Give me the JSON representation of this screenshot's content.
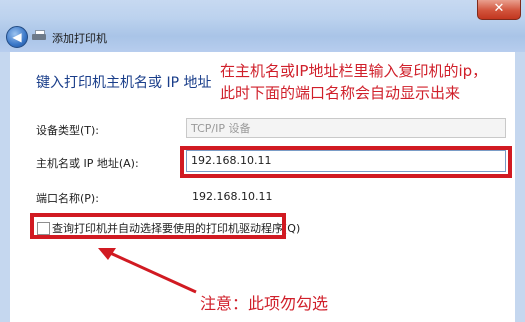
{
  "window": {
    "title": "添加打印机",
    "close_symbol": "✕",
    "back_symbol": "◀"
  },
  "main": {
    "heading": "键入打印机主机名或 IP 地址",
    "annotation_line1": "在主机名或IP地址栏里输入复印机的ip，",
    "annotation_line2": "此时下面的端口名称会自动显示出来",
    "device_type_label": "设备类型(T):",
    "device_type_value": "TCP/IP 设备",
    "host_label": "主机名或 IP 地址(A):",
    "host_value": "192.168.10.11",
    "port_label": "端口名称(P):",
    "port_value": "192.168.10.11",
    "query_checkbox_label": "查询打印机并自动选择要使用的打印机驱动程序(Q)",
    "note": "注意：此项勿勾选"
  },
  "colors": {
    "annotation_red": "#d11a22",
    "heading_blue": "#1a3e8a"
  }
}
